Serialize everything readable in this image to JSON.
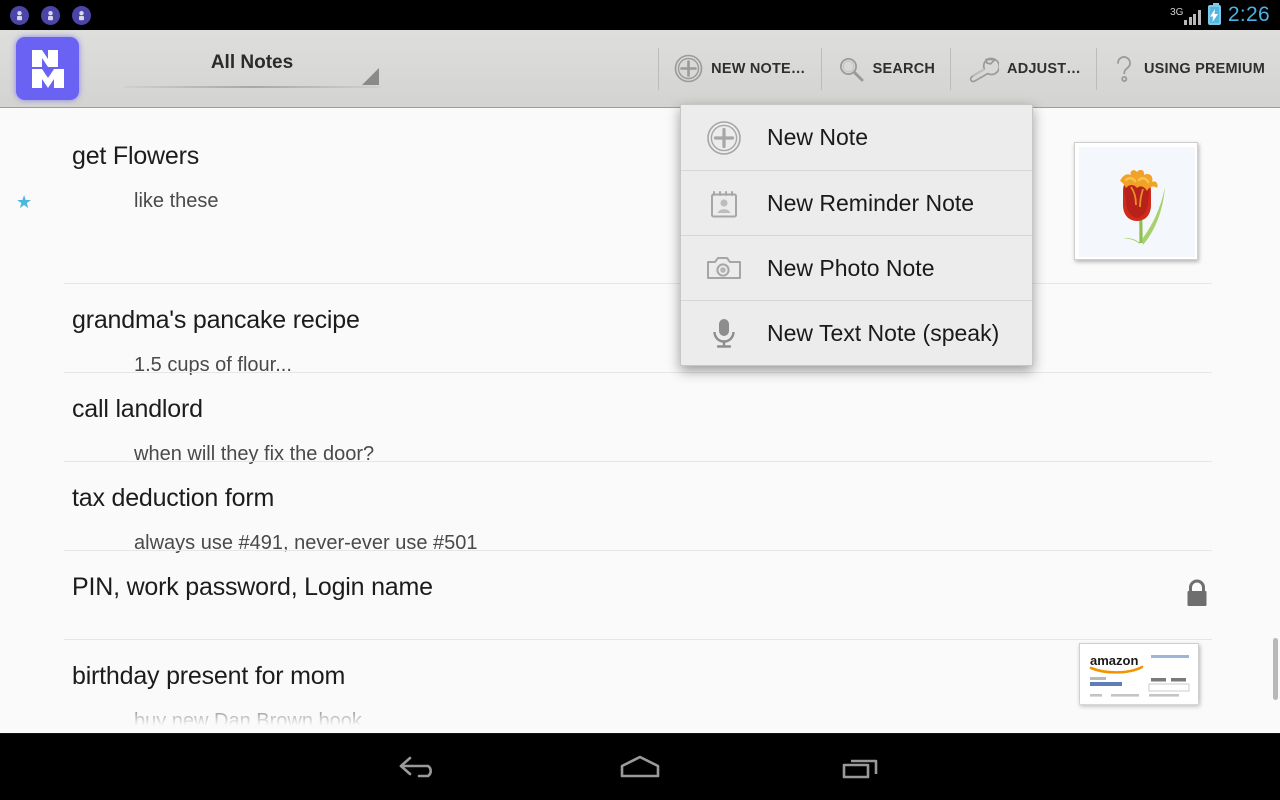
{
  "statusbar": {
    "notifications": [
      "notification-icon",
      "notification-icon",
      "notification-icon"
    ],
    "network_label": "3G",
    "battery_icon": "battery-charging-icon",
    "time": "2:26",
    "time_color": "#4ab3e3"
  },
  "actionbar": {
    "app_logo": "app-logo-nm",
    "spinner": {
      "label": "All Notes",
      "arrow_icon": "dropdown-triangle-icon"
    },
    "toolbar": [
      {
        "label": "NEW NOTE…",
        "icon": "plus-circle-icon"
      },
      {
        "label": "SEARCH",
        "icon": "search-icon"
      },
      {
        "label": "ADJUST…",
        "icon": "wrench-icon"
      },
      {
        "label": "USING PREMIUM",
        "icon": "question-mark-icon"
      }
    ]
  },
  "popup_menu": {
    "items": [
      {
        "label": "New Note",
        "icon": "plus-circle-icon"
      },
      {
        "label": "New Reminder Note",
        "icon": "calendar-reminder-icon"
      },
      {
        "label": "New Photo Note",
        "icon": "camera-icon"
      },
      {
        "label": "New Text Note (speak)",
        "icon": "microphone-icon"
      }
    ]
  },
  "notes": [
    {
      "title": "get Flowers",
      "subtitle": "like these",
      "starred": true,
      "star_icon": "star-icon",
      "star_color": "#4cb7dd",
      "thumbnail": "tulip-photo-thumbnail",
      "locked": false
    },
    {
      "title": "grandma's pancake recipe",
      "subtitle": "1.5 cups of flour...",
      "starred": false,
      "thumbnail": null,
      "locked": false
    },
    {
      "title": "call landlord",
      "subtitle": "when will they fix the door?",
      "starred": false,
      "thumbnail": null,
      "locked": false
    },
    {
      "title": "tax deduction form",
      "subtitle": "always use #491, never-ever use #501",
      "starred": false,
      "thumbnail": null,
      "locked": false
    },
    {
      "title": "PIN, work password, Login name",
      "subtitle": "",
      "starred": false,
      "thumbnail": null,
      "locked": true,
      "lock_icon": "lock-icon"
    },
    {
      "title": "birthday present for mom",
      "subtitle": "buy new Dan Brown book",
      "starred": false,
      "thumbnail": "amazon-page-thumbnail",
      "thumbnail_text": "amazon",
      "locked": false
    }
  ],
  "navbar": {
    "back": "back-icon",
    "home": "home-icon",
    "recents": "recent-apps-icon"
  }
}
